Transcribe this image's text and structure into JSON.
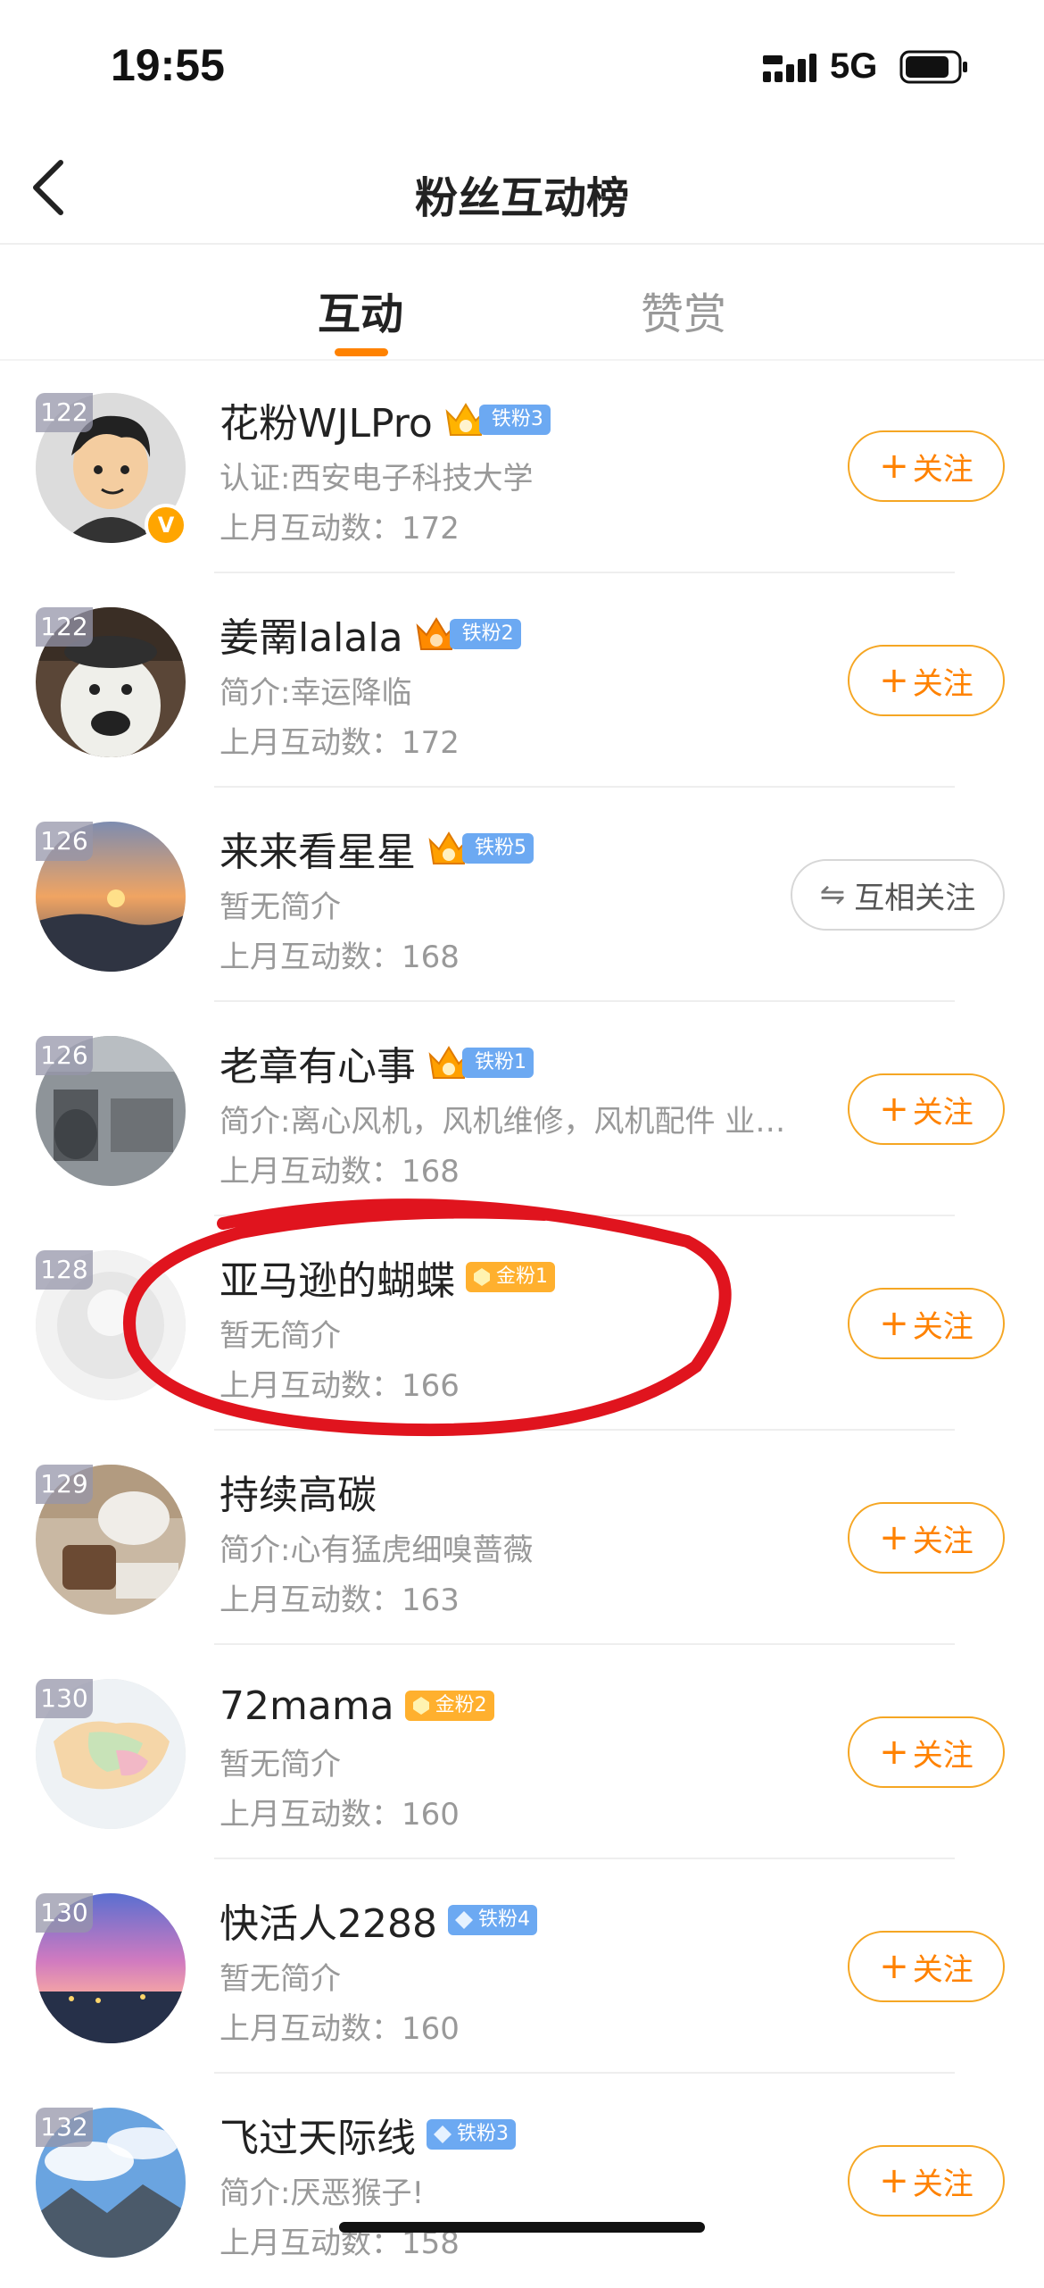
{
  "status_bar": {
    "time": "19:55",
    "network": "5G"
  },
  "nav": {
    "title": "粉丝互动榜"
  },
  "tabs": [
    {
      "label": "互动",
      "active": true
    },
    {
      "label": "赞赏",
      "active": false
    }
  ],
  "colors": {
    "accent": "#ff8200",
    "iron_badge": "#6ca9f2",
    "gold_badge": "#ffb02e",
    "annotation": "#e0141e"
  },
  "items": [
    {
      "rank": "122",
      "name": "花粉WJLPro",
      "badge": "铁粉3",
      "desc": "认证:西安电子科技大学",
      "count": "上月互动数：172",
      "button": "关注",
      "verified": true
    },
    {
      "rank": "122",
      "name": "姜罱lalala",
      "badge": "铁粉2",
      "desc": "简介:幸运降临",
      "count": "上月互动数：172",
      "button": "关注"
    },
    {
      "rank": "126",
      "name": "来来看星星",
      "badge": "铁粉5",
      "desc": "暂无简介",
      "count": "上月互动数：168",
      "button": "互相关注"
    },
    {
      "rank": "126",
      "name": "老章有心事",
      "badge": "铁粉1",
      "desc": "简介:离心风机，风机维修，风机配件 业…",
      "count": "上月互动数：168",
      "button": "关注"
    },
    {
      "rank": "128",
      "name": "亚马逊的蝴蝶",
      "badge": "金粉1",
      "desc": "暂无简介",
      "count": "上月互动数：166",
      "button": "关注"
    },
    {
      "rank": "129",
      "name": "持续高碳",
      "badge": "",
      "desc": "简介:心有猛虎细嗅蔷薇",
      "count": "上月互动数：163",
      "button": "关注"
    },
    {
      "rank": "130",
      "name": "72mama",
      "badge": "金粉2",
      "desc": "暂无简介",
      "count": "上月互动数：160",
      "button": "关注"
    },
    {
      "rank": "130",
      "name": "快活人2288",
      "badge": "铁粉4",
      "desc": "暂无简介",
      "count": "上月互动数：160",
      "button": "关注"
    },
    {
      "rank": "132",
      "name": "飞过天际线",
      "badge": "铁粉3",
      "desc": "简介:厌恶猴子!",
      "count": "上月互动数：158",
      "button": "关注"
    }
  ]
}
